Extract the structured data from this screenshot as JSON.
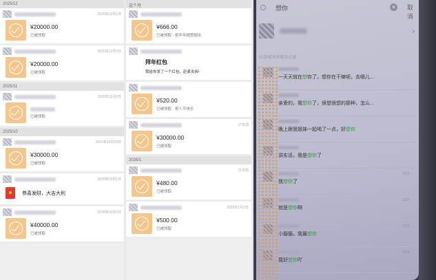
{
  "col1": {
    "sections": [
      {
        "month": "2025/12",
        "cards": [
          {
            "time": "2025年12月1日",
            "amount": "¥20000.00",
            "status": "已被领取"
          },
          {
            "time": "2025年12月2日",
            "amount": "¥20000.00",
            "status": "已被领取"
          }
        ]
      },
      {
        "month": "2025/11",
        "cards": [
          {
            "time": "2025年11月5日",
            "amount": "",
            "status": "已被领取"
          }
        ]
      },
      {
        "month": "2025/10",
        "cards": [
          {
            "time": "2025年10月30日",
            "amount": "¥30000.00",
            "status": "已被领取"
          }
        ]
      }
    ],
    "gift": {
      "time": "2025年10月1日",
      "text": "恭喜发财，大吉大利"
    },
    "last": {
      "time": "2025年10月2日",
      "amount": "¥40000.00",
      "status": "已被领取"
    }
  },
  "col2": {
    "header": "这个月",
    "cards": [
      {
        "amount": "¥666.00",
        "status": "已被领取 · 祝年年顺意顺水"
      },
      {
        "title": "拜年红包",
        "subtitle": "我给你发了一个红包，赶紧去拆!"
      },
      {
        "amount": "¥520.00",
        "status": "已被领取 · 祝人节快乐"
      },
      {
        "time": "17年前",
        "amount": "¥30000.00",
        "status": "已被领取"
      }
    ],
    "month2": "2026/1",
    "cards2": [
      {
        "time": "21天前",
        "amount": "¥480.00",
        "status": "已被领取"
      },
      {
        "time": "2026年1月2日",
        "amount": "¥500.00",
        "status": "已被领取"
      }
    ]
  },
  "phone": {
    "search_keyword": "想你",
    "cancel": "取消",
    "section_label": "52条相关的聊天记录",
    "messages": [
      {
        "date": "",
        "pre": "一天天就在",
        "hl": "想",
        "post": "你了，想你在干嘛呢，去哪儿..."
      },
      {
        "date": "",
        "pre": "亲爱的，我",
        "hl": "想你",
        "post": "了，很想很想的那种，怎么..."
      },
      {
        "date": "",
        "pre": "晚上跟我姐妹一起喝了一点，好",
        "hl": "想你",
        "post": ""
      },
      {
        "date": "",
        "pre": "讲实话，我是",
        "hl": "想你",
        "post": "了"
      },
      {
        "date": "2/19",
        "pre": "我",
        "hl": "想你",
        "post": "了"
      },
      {
        "date": "2/22",
        "pre": "就是",
        "hl": "想你",
        "post": "啊"
      },
      {
        "date": "2/23",
        "pre": "小猫猫，我最",
        "hl": "想你",
        "post": ""
      },
      {
        "date": "2/24",
        "pre": "我好",
        "hl": "想你",
        "post": "吖"
      }
    ]
  }
}
